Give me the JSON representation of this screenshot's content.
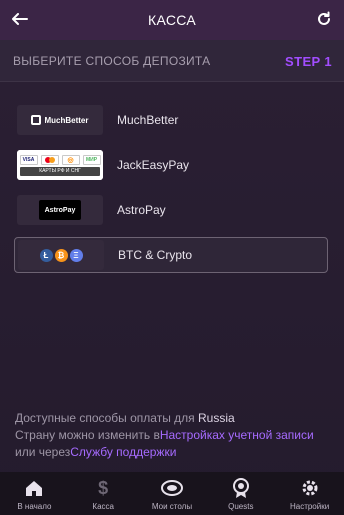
{
  "header": {
    "title": "КАССА",
    "back_icon": "arrow-left-icon",
    "refresh_icon": "refresh-icon"
  },
  "step": {
    "title": "ВЫБЕРИТЕ СПОСОБ ДЕПОЗИТА",
    "number": "STEP 1"
  },
  "methods": [
    {
      "name": "MuchBetter",
      "logo_text": "MuchBetter",
      "selected": false
    },
    {
      "name": "JackEasyPay",
      "logo_caption": "КАРТЫ РФ И СНГ",
      "cards": [
        "VISA",
        "MC",
        "QIWI",
        "МИР"
      ],
      "selected": false
    },
    {
      "name": "AstroPay",
      "logo_text": "AstroPay",
      "selected": false
    },
    {
      "name": "BTC & Crypto",
      "coins": [
        "Ł",
        "₿",
        "Ξ"
      ],
      "selected": true
    }
  ],
  "info": {
    "line1_prefix": "Доступные способы оплаты для ",
    "country": "Russia",
    "line2_prefix": "Страну можно изменить в",
    "settings_link": "Настройках учетной записи",
    "line3_prefix": "или через",
    "support_link": "Службу поддержки"
  },
  "nav": [
    {
      "label": "В начало",
      "icon": "home-icon"
    },
    {
      "label": "Касса",
      "icon": "dollar-icon"
    },
    {
      "label": "Мои столы",
      "icon": "tables-icon"
    },
    {
      "label": "Quests",
      "icon": "medal-icon"
    },
    {
      "label": "Настройки",
      "icon": "gear-icon"
    }
  ],
  "colors": {
    "accent": "#a24dff",
    "link": "#a66bff",
    "background": "#241b2d",
    "header": "#3b2546"
  }
}
